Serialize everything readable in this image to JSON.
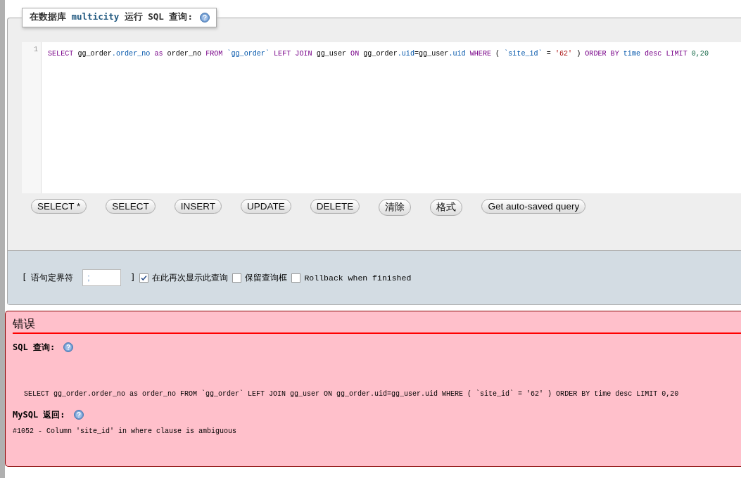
{
  "query_panel": {
    "legend": {
      "prefix": "在数据库",
      "database": "multicity",
      "suffix": "运行 SQL 查询:"
    },
    "editor": {
      "line_number": "1",
      "tokens": [
        {
          "kind": "keyword",
          "text": "SELECT"
        },
        {
          "kind": "plain",
          "text": " gg_order"
        },
        {
          "kind": "property",
          "text": ".order_no"
        },
        {
          "kind": "keyword",
          "text": " as"
        },
        {
          "kind": "plain",
          "text": " order_no "
        },
        {
          "kind": "keyword",
          "text": "FROM"
        },
        {
          "kind": "quoted",
          "text": " `gg_order`"
        },
        {
          "kind": "keyword",
          "text": " LEFT JOIN"
        },
        {
          "kind": "plain",
          "text": " gg_user "
        },
        {
          "kind": "keyword",
          "text": "ON"
        },
        {
          "kind": "plain",
          "text": " gg_order"
        },
        {
          "kind": "property",
          "text": ".uid"
        },
        {
          "kind": "plain",
          "text": "=gg_user"
        },
        {
          "kind": "property",
          "text": ".uid"
        },
        {
          "kind": "keyword",
          "text": " WHERE"
        },
        {
          "kind": "plain",
          "text": " ( "
        },
        {
          "kind": "quoted",
          "text": "`site_id`"
        },
        {
          "kind": "plain",
          "text": " = "
        },
        {
          "kind": "string",
          "text": "'62'"
        },
        {
          "kind": "plain",
          "text": " ) "
        },
        {
          "kind": "keyword",
          "text": "ORDER BY"
        },
        {
          "kind": "property",
          "text": " time"
        },
        {
          "kind": "keyword",
          "text": " desc"
        },
        {
          "kind": "keyword",
          "text": " LIMIT"
        },
        {
          "kind": "number",
          "text": " 0,20"
        }
      ]
    },
    "buttons": [
      "SELECT *",
      "SELECT",
      "INSERT",
      "UPDATE",
      "DELETE",
      "清除",
      "格式",
      "Get auto-saved query"
    ],
    "options": {
      "delimiter_open": "[",
      "delimiter_label": "语句定界符",
      "delimiter_value": ";",
      "delimiter_close": "]",
      "checkboxes": [
        {
          "label": "在此再次显示此查询",
          "checked": true
        },
        {
          "label": "保留查询框",
          "checked": false
        },
        {
          "label": "Rollback when finished",
          "checked": false
        }
      ]
    }
  },
  "error_panel": {
    "title": "错误",
    "query_label": "SQL 查询:",
    "query": "SELECT gg_order.order_no as order_no FROM `gg_order` LEFT JOIN gg_user ON gg_order.uid=gg_user.uid WHERE ( `site_id` = '62' ) ORDER BY time desc LIMIT 0,20",
    "response_label": "MySQL 返回:",
    "message": "#1052 - Column 'site_id' in where clause is ambiguous"
  }
}
